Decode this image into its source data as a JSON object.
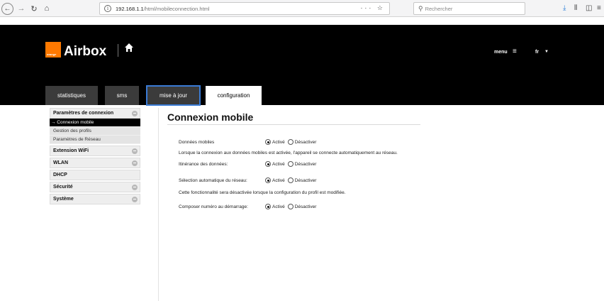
{
  "browser": {
    "url_host": "192.168.1.1",
    "url_path": "/html/mobileconnection.html",
    "url_actions": "··· ☆",
    "search_placeholder": "Rechercher"
  },
  "header": {
    "logo_badge": "orange",
    "logo_text": "Airbox",
    "menu_label": "menu",
    "menu_icon": "≡",
    "language": "fr",
    "brand_color": "#ff7900"
  },
  "tabs": [
    {
      "label": "statistiques"
    },
    {
      "label": "sms"
    },
    {
      "label": "mise à jour"
    },
    {
      "label": "configuration"
    }
  ],
  "sidebar": {
    "sections": [
      {
        "label": "Paramètres de connexion"
      },
      {
        "label": "Extension WiFi"
      },
      {
        "label": "WLAN"
      },
      {
        "label": "DHCP"
      },
      {
        "label": "Sécurité"
      },
      {
        "label": "Système"
      }
    ],
    "subitems": [
      {
        "label": "→ Connexion mobile"
      },
      {
        "label": "Gestion des profils"
      },
      {
        "label": "Paramètres de Réseau"
      }
    ]
  },
  "main": {
    "title": "Connexion mobile",
    "option_on": "Activé",
    "option_off": "Désactiver",
    "rows": [
      {
        "label": "Données mobiles",
        "value": "Activé"
      },
      {
        "label": "Itinérance des données:",
        "value": "Activé"
      },
      {
        "label": "Sélection automatique du réseau:",
        "value": "Activé"
      },
      {
        "label": "Composer numéro au démarrage:",
        "value": "Activé"
      }
    ],
    "notes": [
      "Lorsque la connexion aux données mobiles est activée, l'appareil se connecte automatiquement au réseau.",
      "Cette fonctionnalité sera désactivée lorsque la configuration du profil est modifiée."
    ]
  }
}
